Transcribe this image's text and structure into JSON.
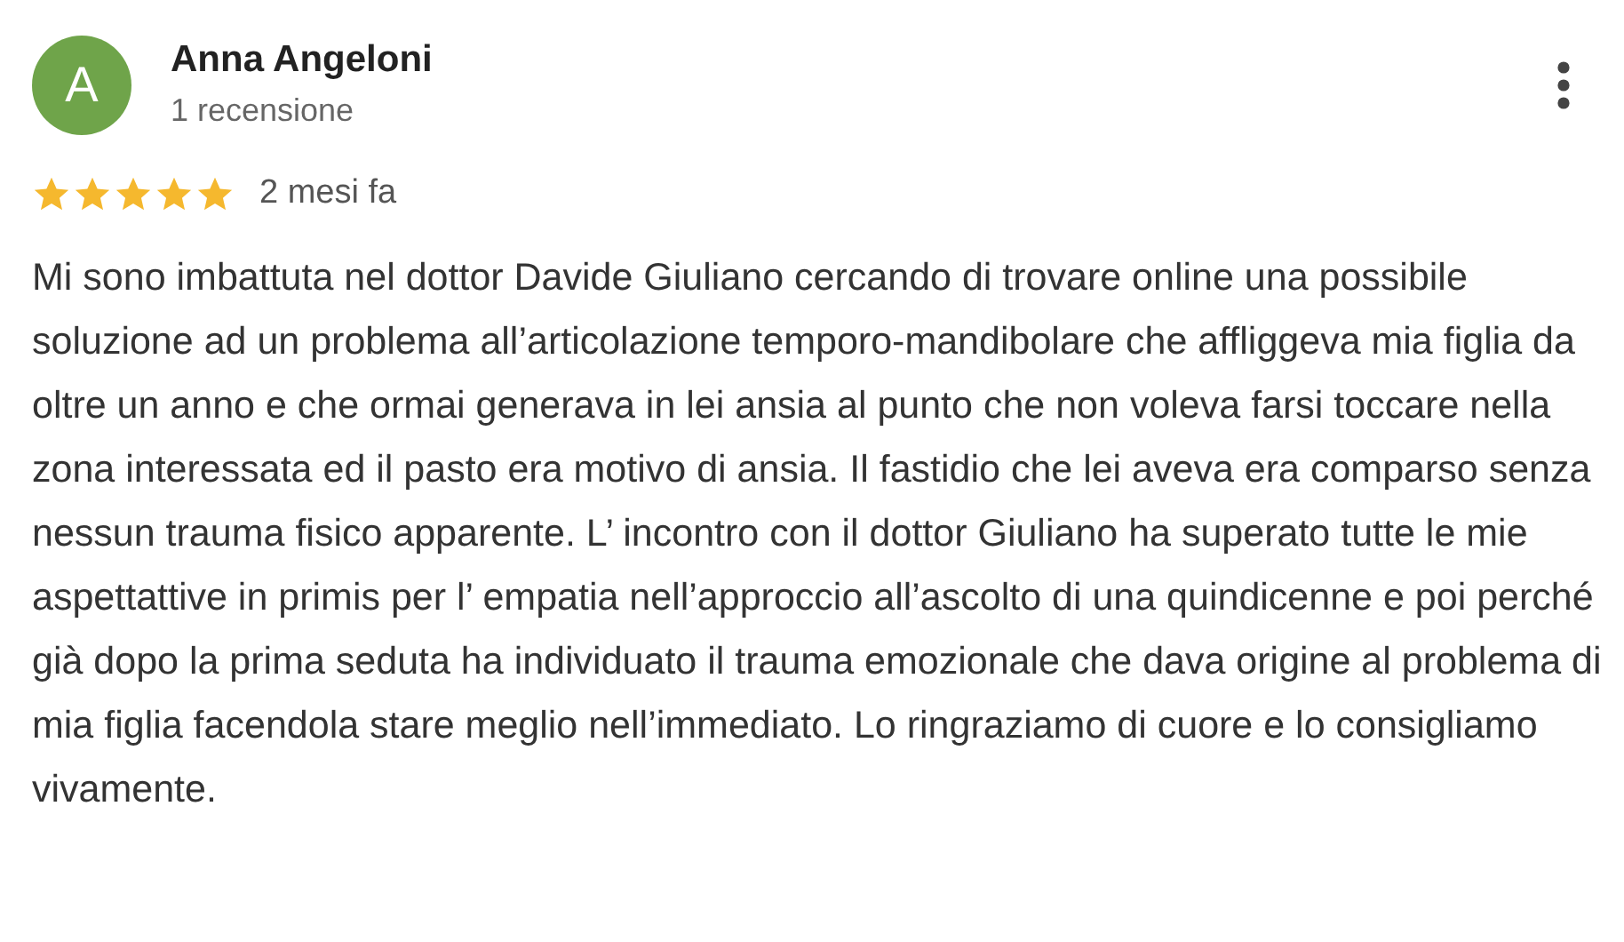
{
  "review": {
    "avatar_letter": "A",
    "author": "Anna Angeloni",
    "author_meta": "1 recensione",
    "stars": 5,
    "date": "2 mesi fa",
    "text": "Mi sono imbattuta nel dottor Davide Giuliano cercando di trovare online una possibile soluzione ad un problema all’articolazione temporo-mandibolare che affliggeva mia figlia da oltre un anno e che ormai generava in lei ansia al punto che non voleva farsi toccare nella zona interessata ed il pasto era motivo di ansia. Il fastidio che lei aveva era comparso senza nessun trauma fisico apparente. L’ incontro con il dottor Giuliano ha superato tutte le mie aspettattive in primis per l’ empatia nell’approccio all’ascolto di una quindicenne e poi perché già dopo la prima seduta ha individuato il trauma emozionale che dava origine al problema di mia figlia facendola stare meglio nell’immediato. Lo ringraziamo di cuore e lo consigliamo vivamente."
  }
}
